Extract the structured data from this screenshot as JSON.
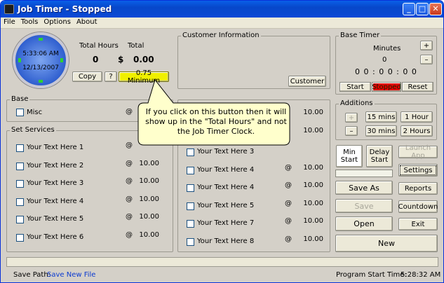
{
  "window": {
    "title": "Job Timer - Stopped",
    "btn_min": "_",
    "btn_max": "□",
    "btn_close": "✕"
  },
  "menu": [
    "File",
    "Tools",
    "Options",
    "About"
  ],
  "clock": {
    "time": "5:33:06 AM",
    "date": "12/13/2007"
  },
  "totals": {
    "hours_label": "Total Hours",
    "total_label": "Total",
    "hours_value": "0",
    "currency": "$",
    "total_value": "0.00"
  },
  "actions": {
    "copy": "Copy",
    "help": "?",
    "minimum": "0.75 Minimum"
  },
  "customer": {
    "legend": "Customer Information",
    "button": "Customer"
  },
  "base_timer": {
    "legend": "Base Timer",
    "minutes_label": "Minutes",
    "minutes_value": "0",
    "plus": "+",
    "minus": "–",
    "display": "0 0 : 0 0 : 0 0",
    "start": "Start",
    "status": "Stopped",
    "reset": "Reset"
  },
  "base": {
    "legend": "Base",
    "misc": "Misc",
    "at": "@"
  },
  "callout": "If you click on this button then it will show up in the \"Total Hours\" and not the Job Timer Clock.",
  "set_services": {
    "legend": "Set Services",
    "items": [
      {
        "label": "Your Text Here 1",
        "at": "@",
        "rate": ""
      },
      {
        "label": "Your Text Here 2",
        "at": "@",
        "rate": "10.00"
      },
      {
        "label": "Your Text Here 3",
        "at": "@",
        "rate": "10.00"
      },
      {
        "label": "Your Text Here 4",
        "at": "@",
        "rate": "10.00"
      },
      {
        "label": "Your Text Here 5",
        "at": "@",
        "rate": "10.00"
      },
      {
        "label": "Your Text Here 6",
        "at": "@",
        "rate": "10.00"
      }
    ]
  },
  "services2": {
    "items": [
      {
        "label": "Your Text Here 3",
        "at": "",
        "rate": ""
      },
      {
        "label": "Your Text Here 4",
        "at": "@",
        "rate": "10.00"
      },
      {
        "label": "Your Text Here 4",
        "at": "@",
        "rate": "10.00"
      },
      {
        "label": "Your Text Here 5",
        "at": "@",
        "rate": "10.00"
      },
      {
        "label": "Your Text Here 7",
        "at": "@",
        "rate": "10.00"
      },
      {
        "label": "Your Text Here 8",
        "at": "@",
        "rate": "10.00"
      }
    ],
    "rate_top1": "10.00",
    "rate_top2": "10.00"
  },
  "additions": {
    "legend": "Additions",
    "plus": "+",
    "minus": "–",
    "b15": "15 mins",
    "b1h": "1 Hour",
    "b30": "30 mins",
    "b2h": "2 Hours"
  },
  "controls": {
    "min_start": "Min Start",
    "delay_start": "Delay Start",
    "launch_app": "Launch App",
    "settings": "Settings",
    "save_as": "Save As",
    "reports": "Reports",
    "save": "Save",
    "countdown": "Countdown",
    "open": "Open",
    "exit": "Exit",
    "new": "New"
  },
  "footer": {
    "save_path_label": "Save Path:",
    "save_path_value": "Save New File",
    "start_time_label": "Program Start Time:",
    "start_time_value": "5:28:32 AM"
  }
}
